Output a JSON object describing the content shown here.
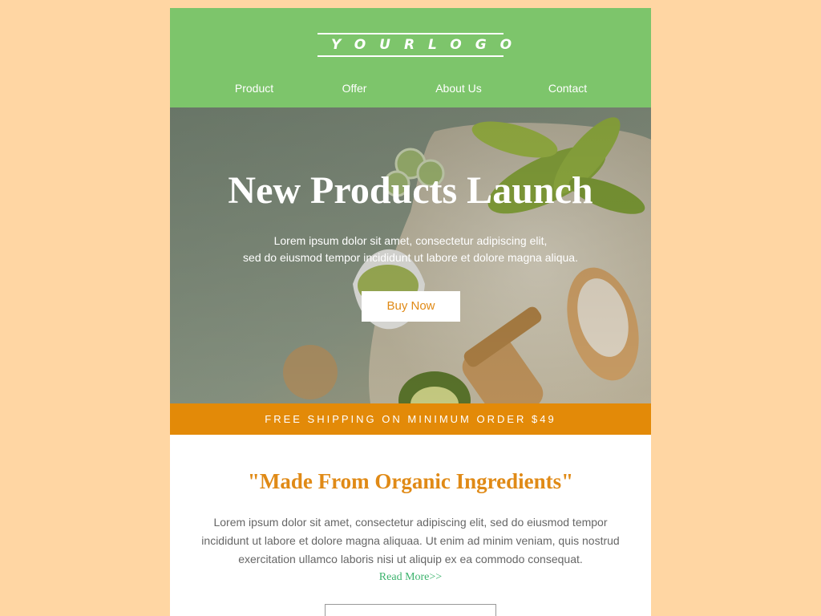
{
  "logo": {
    "text": "YOURLOGO"
  },
  "nav": {
    "items": [
      {
        "label": "Product"
      },
      {
        "label": "Offer"
      },
      {
        "label": "About Us"
      },
      {
        "label": "Contact"
      }
    ]
  },
  "hero": {
    "title": "New Products Launch",
    "text_line1": "Lorem ipsum dolor sit amet, consectetur adipiscing elit,",
    "text_line2": "sed do eiusmod tempor incididunt ut labore et dolore magna aliqua.",
    "button_label": "Buy Now"
  },
  "shipping_banner": {
    "text": "FREE SHIPPING ON MINIMUM ORDER $49"
  },
  "section": {
    "title": "\"Made From Organic Ingredients\"",
    "text_line1": "Lorem ipsum dolor sit amet, consectetur adipiscing elit, sed do eiusmod tempor",
    "text_line2": "incididunt ut labore et dolore magna aliquaa. Ut enim ad minim veniam, quis nostrud",
    "text_line3": "exercitation ullamco laboris nisi ut aliquip ex ea commodo consequat.",
    "read_more": "Read More>>"
  },
  "colors": {
    "page_background": "#ffd6a3",
    "header_green": "#7dc56b",
    "accent_orange": "#e38a08",
    "link_green": "#3cb36d"
  }
}
